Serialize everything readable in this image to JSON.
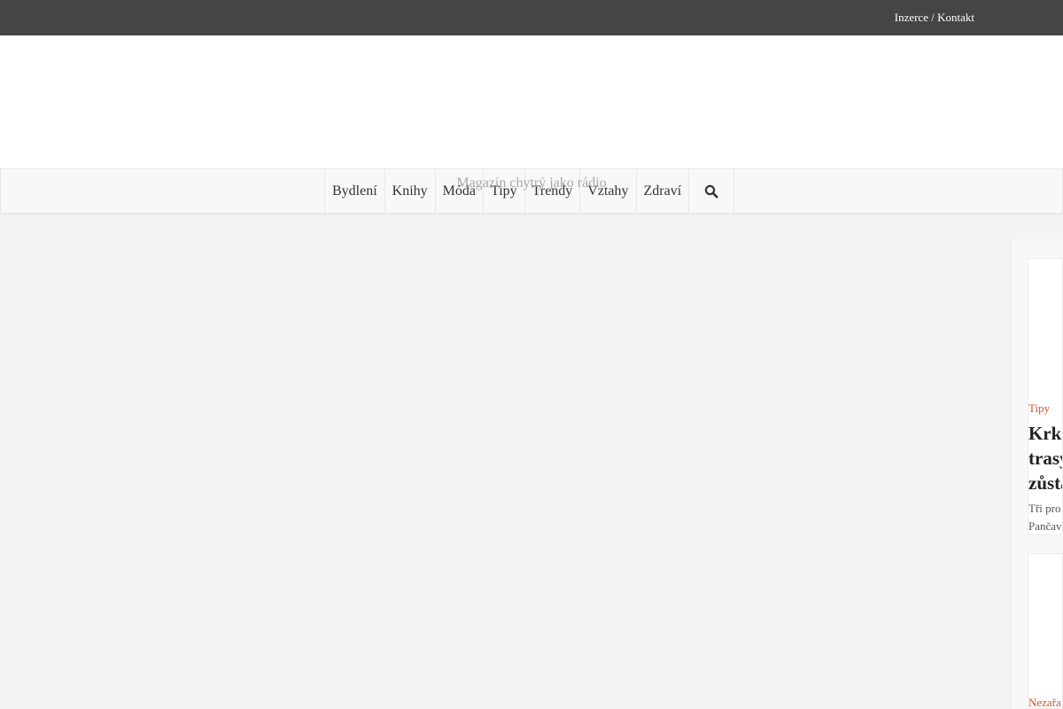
{
  "topbar": {
    "links": [
      "Inzerce",
      "Kontakt"
    ],
    "separator": " / "
  },
  "header": {
    "tagline": "Magazín chytrý jako rádio"
  },
  "nav": {
    "items": [
      {
        "label": "Bydlení"
      },
      {
        "label": "Knihy"
      },
      {
        "label": "Móda"
      },
      {
        "label": "Tipy"
      },
      {
        "label": "Trendy"
      },
      {
        "label": "Vztahy"
      },
      {
        "label": "Zdraví"
      }
    ],
    "search_icon": "search-icon"
  },
  "sidebar": {
    "cards": [
      {
        "category": "Tipy",
        "title_lines": [
          "Krk",
          "trasy",
          "zůsta"
        ],
        "excerpt_lines": [
          "Tři pro",
          "Pančav"
        ]
      },
      {
        "category": "Nezařa"
      }
    ]
  },
  "colors": {
    "topbar": "#454545",
    "accent": "#d9502a",
    "background": "#f3f3f3"
  }
}
